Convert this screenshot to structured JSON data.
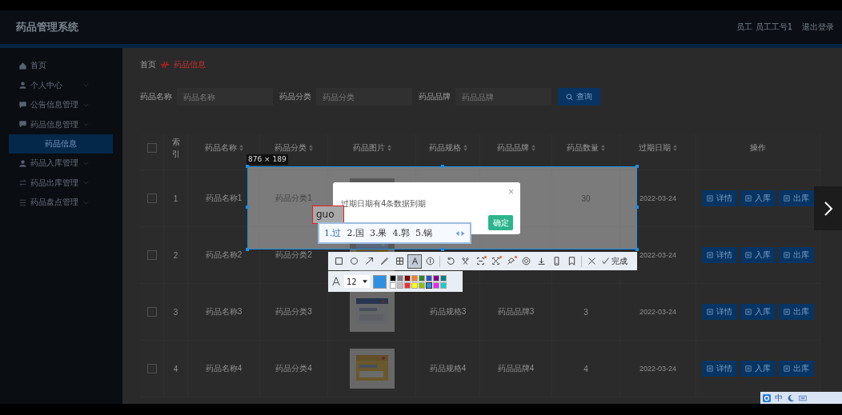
{
  "header": {
    "title": "药品管理系统",
    "user": "员工 员工工号1",
    "logout": "退出登录"
  },
  "sidebar": {
    "items": [
      {
        "label": "首页",
        "kind": "home",
        "expandable": false
      },
      {
        "label": "个人中心",
        "kind": "user",
        "expandable": true
      },
      {
        "label": "公告信息管理",
        "kind": "chat",
        "expandable": true
      },
      {
        "label": "药品信息管理",
        "kind": "chat",
        "expandable": true,
        "children": [
          {
            "label": "药品信息",
            "selected": true
          }
        ]
      },
      {
        "label": "药品入库管理",
        "kind": "user",
        "expandable": true
      },
      {
        "label": "药品出库管理",
        "kind": "transfer",
        "expandable": true
      },
      {
        "label": "药品盘点管理",
        "kind": "list",
        "expandable": true
      }
    ]
  },
  "breadcrumb": [
    "首页",
    "药品信息"
  ],
  "search": {
    "fields": [
      {
        "label": "药品名称",
        "placeholder": "药品名称"
      },
      {
        "label": "药品分类",
        "placeholder": "药品分类"
      },
      {
        "label": "药品品牌",
        "placeholder": "药品品牌"
      }
    ],
    "button": "查询"
  },
  "table": {
    "select_all_checked": false,
    "columns": [
      {
        "label": "索引",
        "sortable": false
      },
      {
        "label": "药品名称",
        "sortable": true
      },
      {
        "label": "药品分类",
        "sortable": true
      },
      {
        "label": "药品图片",
        "sortable": true
      },
      {
        "label": "药品规格",
        "sortable": true
      },
      {
        "label": "药品品牌",
        "sortable": true
      },
      {
        "label": "药品数量",
        "sortable": true
      },
      {
        "label": "过期日期",
        "sortable": true
      },
      {
        "label": "操作",
        "sortable": false
      }
    ],
    "rows": [
      {
        "checked": false,
        "index": "1",
        "name": "药品名称1",
        "category": "药品分类1",
        "qty": "30",
        "date": "2022-03-24",
        "picture": {
          "kind": "picture"
        },
        "actions": [
          "详情",
          "入库",
          "出库"
        ]
      },
      {
        "checked": false,
        "index": "2",
        "name": "药品名称2",
        "category": "药品分类2",
        "date": "2022-03-24",
        "picture": {
          "kind": "picture"
        },
        "actions": [
          "详情",
          "入库",
          "出库"
        ]
      },
      {
        "checked": false,
        "index": "3",
        "name": "药品名称3",
        "category": "药品分类3",
        "spec": "药品规格3",
        "brand": "药品品牌3",
        "qty": "3",
        "date": "2022-03-24",
        "picture": {
          "kind": "picture"
        },
        "actions": [
          "详情",
          "入库",
          "出库"
        ]
      },
      {
        "checked": false,
        "index": "4",
        "name": "药品名称4",
        "category": "药品分类4",
        "spec": "药品规格4",
        "brand": "药品品牌4",
        "qty": "4",
        "date": "2022-03-24",
        "picture": {
          "kind": "picture"
        },
        "actions": [
          "详情",
          "入库",
          "出库"
        ]
      }
    ]
  },
  "dialog": {
    "message": "过期日期有4条数据到期",
    "confirm": "确定",
    "close": "×"
  },
  "capture": {
    "size": "876 × 189",
    "tools": [
      {
        "kind": "rect",
        "selected": false
      },
      {
        "kind": "ellipse",
        "selected": false
      },
      {
        "kind": "arrow",
        "selected": false
      },
      {
        "kind": "pen",
        "selected": false
      },
      {
        "kind": "mosaic",
        "selected": false
      },
      {
        "kind": "text",
        "selected": true
      },
      {
        "kind": "number",
        "selected": false
      },
      {
        "kind": "sep"
      },
      {
        "kind": "undo",
        "selected": false
      },
      {
        "kind": "cut",
        "selected": false
      },
      {
        "kind": "ocr",
        "selected": false,
        "badge": true
      },
      {
        "kind": "scan",
        "selected": false,
        "badge": true
      },
      {
        "kind": "pin",
        "selected": false,
        "badge": true
      },
      {
        "kind": "record",
        "selected": false
      },
      {
        "kind": "save",
        "selected": false
      },
      {
        "kind": "phone",
        "selected": false
      },
      {
        "kind": "bookmark",
        "selected": false
      },
      {
        "kind": "sep"
      },
      {
        "kind": "cancel",
        "selected": false
      },
      {
        "kind": "done",
        "selected": false,
        "label": "完成"
      }
    ],
    "font_size": "12",
    "swatches": [
      {
        "color": "#000000",
        "selected": false
      },
      {
        "color": "#808080",
        "selected": false
      },
      {
        "color": "#800000",
        "selected": false
      },
      {
        "color": "#f08030",
        "selected": false
      },
      {
        "color": "#308030",
        "selected": false
      },
      {
        "color": "#3050c0",
        "selected": false
      },
      {
        "color": "#800080",
        "selected": false
      },
      {
        "color": "#008080",
        "selected": false
      },
      {
        "color": "#ffffff",
        "selected": false
      },
      {
        "color": "#c0c0c0",
        "selected": false
      },
      {
        "color": "#f03030",
        "selected": false
      },
      {
        "color": "#ffff00",
        "selected": false
      },
      {
        "color": "#90c010",
        "selected": false
      },
      {
        "color": "#3090e0",
        "selected": true
      },
      {
        "color": "#f020f0",
        "selected": false
      },
      {
        "color": "#10d0d0",
        "selected": false
      }
    ]
  },
  "ime": {
    "composition": "guo",
    "candidates": [
      {
        "label": "1.过",
        "selected": true
      },
      {
        "label": "2.国",
        "selected": false
      },
      {
        "label": "3.果",
        "selected": false
      },
      {
        "label": "4.郭",
        "selected": false
      },
      {
        "label": "5.锅",
        "selected": false
      }
    ],
    "mode": "中"
  }
}
